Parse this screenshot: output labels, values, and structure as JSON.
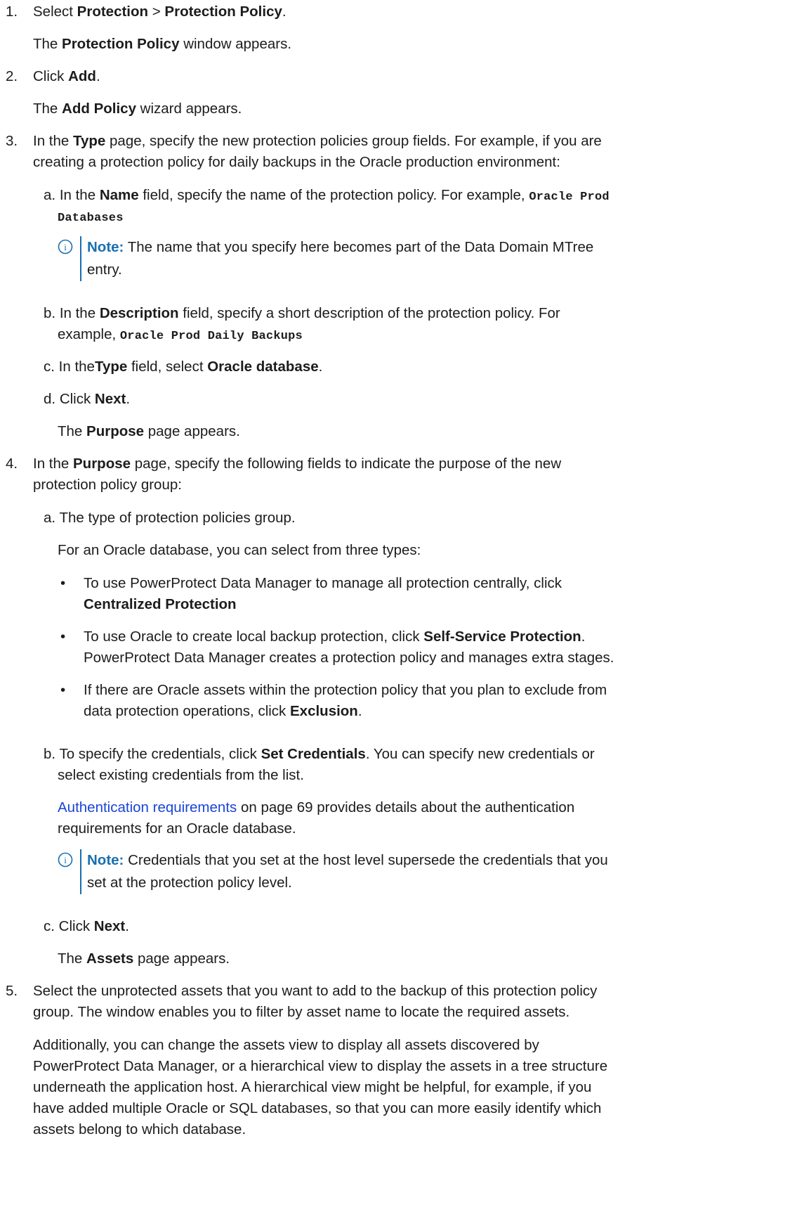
{
  "steps": [
    {
      "num": "1.",
      "pre": "Select ",
      "b1": "Protection",
      "mid": " > ",
      "b2": "Protection Policy",
      "post": ".",
      "result": {
        "pre": "The ",
        "b": "Protection Policy",
        "post": " window appears."
      }
    },
    {
      "num": "2.",
      "pre": "Click ",
      "b": "Add",
      "post": ".",
      "result": {
        "pre": "The ",
        "b": "Add Policy",
        "post": " wizard appears."
      }
    },
    {
      "num": "3.",
      "l1_pre": "In the ",
      "l1_b": "Type",
      "l1_post": " page, specify the new protection policies group fields. For example, if you are",
      "l2": "creating a protection policy for daily backups in the Oracle production environment:",
      "subs": {
        "a": {
          "letter": "a.",
          "l1_pre": "In the ",
          "l1_b": "Name",
          "l1_post": " field, specify the name of the protection policy. For example, ",
          "code1": "Oracle Prod",
          "code2": "Databases",
          "note": {
            "label": "Note:",
            "l1": " The name that you specify here becomes part of the Data Domain MTree",
            "l2": "entry."
          }
        },
        "b": {
          "letter": "b.",
          "l1_pre": "In the ",
          "l1_b": "Description",
          "l1_post": " field, specify a short description of the protection policy. For",
          "l2_pre": "example, ",
          "code": "Oracle Prod Daily Backups"
        },
        "c": {
          "letter": "c.",
          "pre": "In the",
          "b1": "Type",
          "mid": " field, select ",
          "b2": "Oracle database",
          "post": "."
        },
        "d": {
          "letter": "d.",
          "pre": "Click ",
          "b": "Next",
          "post": ".",
          "result": {
            "pre": "The ",
            "b": "Purpose",
            "post": " page appears."
          }
        }
      }
    },
    {
      "num": "4.",
      "l1_pre": "In the ",
      "l1_b": "Purpose",
      "l1_post": " page, specify the following fields to indicate the purpose of the new",
      "l2": "protection policy group:",
      "subs": {
        "a": {
          "letter": "a.",
          "text": "The type of protection policies group.",
          "intro": "For an Oracle database, you can select from three types:",
          "bullets": [
            {
              "l1": "To use PowerProtect Data Manager to manage all protection centrally, click",
              "b": "Centralized Protection"
            },
            {
              "pre": "To use Oracle to create local backup protection, click ",
              "b": "Self-Service Protection",
              "post": ".",
              "l2": "PowerProtect Data Manager creates a protection policy and manages extra stages."
            },
            {
              "l1": "If there are Oracle assets within the protection policy that you plan to exclude from",
              "pre": "data protection operations, click ",
              "b": "Exclusion",
              "post": "."
            }
          ]
        },
        "b": {
          "letter": "b.",
          "l1_pre": "To specify the credentials, click ",
          "l1_b": "Set Credentials",
          "l1_post": ". You can specify new credentials or",
          "l2": "select existing credentials from the list.",
          "link": "Authentication requirements",
          "link_post": " on page 69 provides details about the authentication",
          "link_l2": "requirements for an Oracle database.",
          "note": {
            "label": "Note:",
            "l1": " Credentials that you set at the host level supersede the credentials that you",
            "l2": "set at the protection policy level."
          }
        },
        "c": {
          "letter": "c.",
          "pre": "Click ",
          "b": "Next",
          "post": ".",
          "result": {
            "pre": "The ",
            "b": "Assets",
            "post": " page appears."
          }
        }
      }
    },
    {
      "num": "5.",
      "l1": "Select the unprotected assets that you want to add to the backup of this protection policy",
      "l2": "group. The window enables you to filter by asset name to locate the required assets.",
      "para": [
        "Additionally, you can change the assets view to display all assets discovered by",
        "PowerProtect Data Manager, or a hierarchical view to display the assets in a tree structure",
        "underneath the application host. A hierarchical view might be helpful, for example, if you",
        "have added multiple Oracle or SQL databases, so that you can more easily identify which",
        "assets belong to which database."
      ]
    }
  ],
  "icons": {
    "note": "info-circle-icon"
  },
  "colors": {
    "text": "#1c1c1c",
    "link": "#1a44d9",
    "note_bar": "#1a6fb0"
  }
}
